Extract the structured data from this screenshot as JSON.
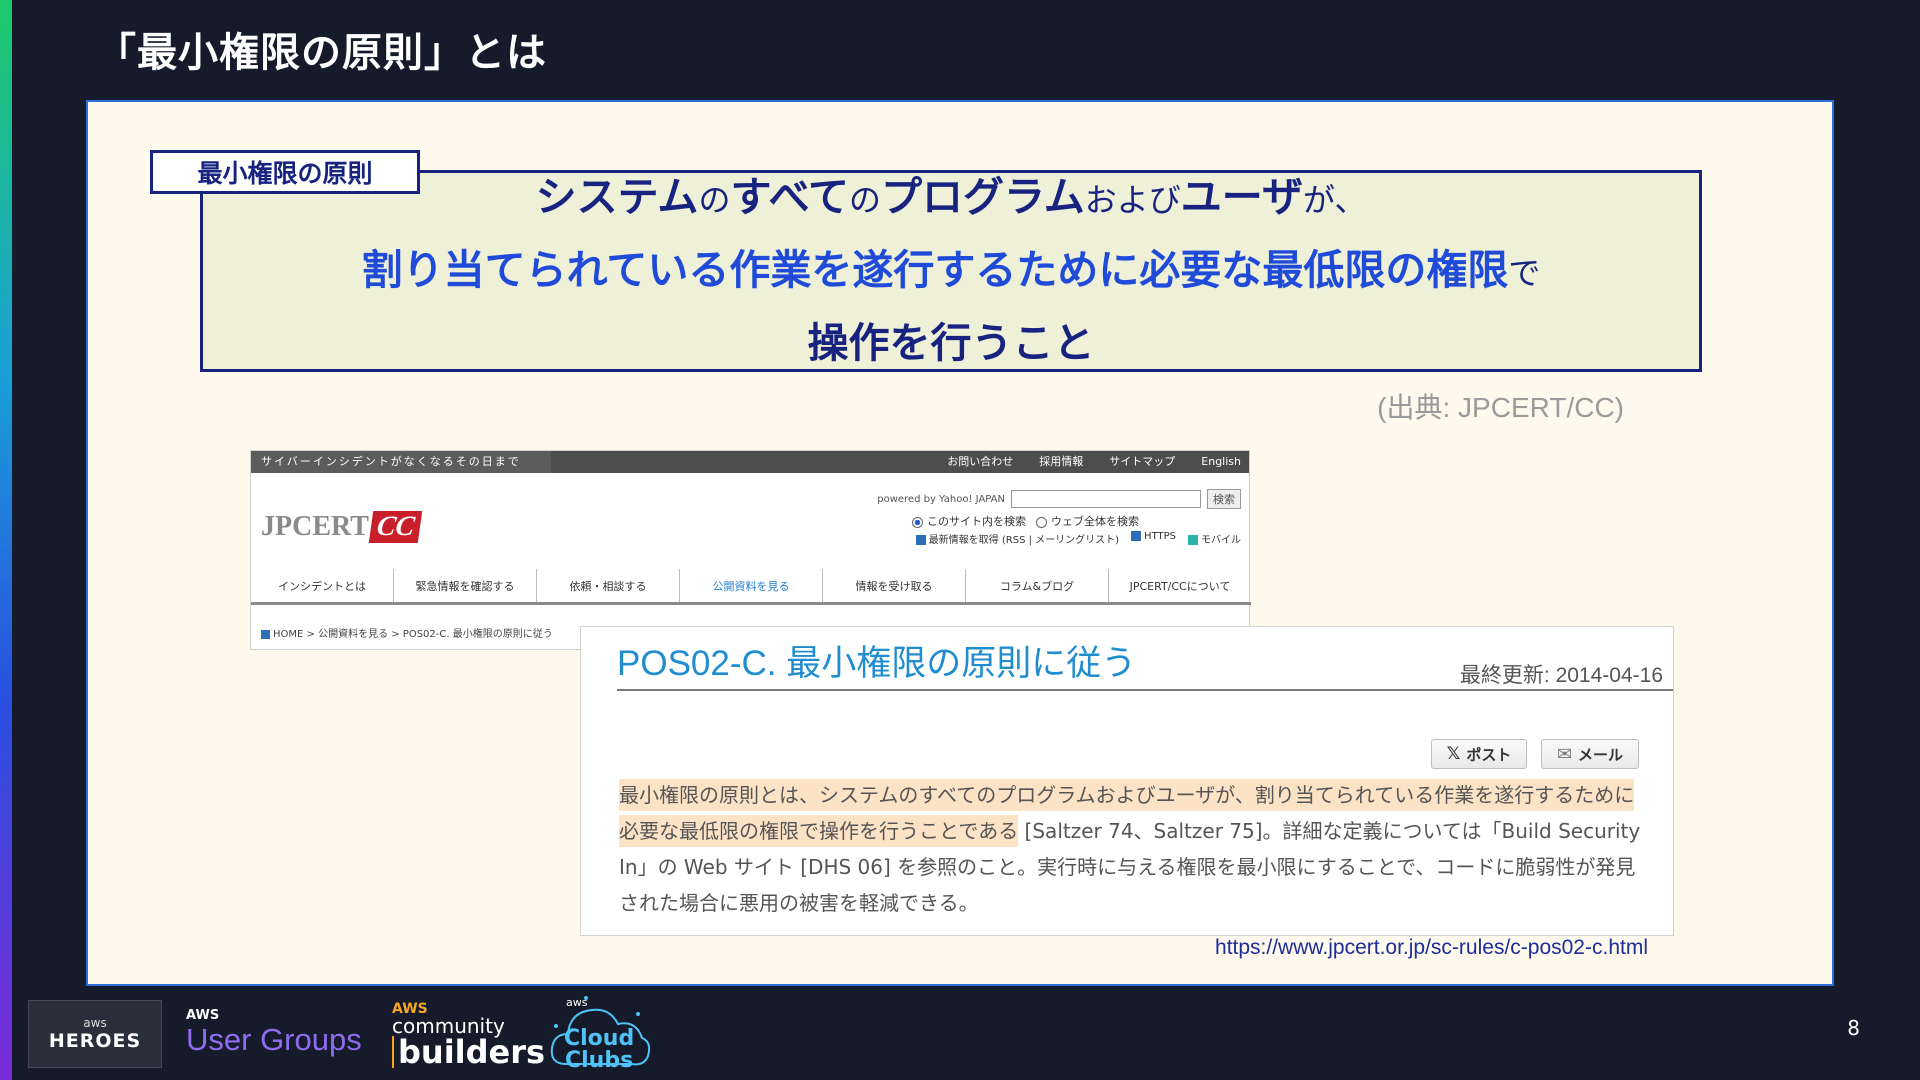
{
  "slide": {
    "title": "「最小権限の原則」とは",
    "page_number": "8"
  },
  "quote": {
    "tag": "最小権限の原則",
    "line1": [
      {
        "text": "システム",
        "size": "big",
        "color": "#17237f"
      },
      {
        "text": "の",
        "size": "small",
        "color": "#17237f"
      },
      {
        "text": "すべて",
        "size": "big",
        "color": "#17237f"
      },
      {
        "text": "の",
        "size": "small",
        "color": "#17237f"
      },
      {
        "text": "プログラム",
        "size": "big",
        "color": "#17237f"
      },
      {
        "text": "および",
        "size": "small",
        "color": "#17237f"
      },
      {
        "text": "ユーザ",
        "size": "big",
        "color": "#17237f"
      },
      {
        "text": "が、",
        "size": "small",
        "color": "#17237f"
      }
    ],
    "line2": [
      {
        "text": "割り当てられている作業を遂行するために必要な最低限の権限",
        "size": "big",
        "color": "#1f4bd8"
      },
      {
        "text": "で",
        "size": "small",
        "color": "#17237f"
      }
    ],
    "line3": [
      {
        "text": "操作を行うこと",
        "size": "big",
        "color": "#17237f"
      }
    ],
    "source": "(出典: JPCERT/CC)"
  },
  "site": {
    "tagline": "サイバーインシデントがなくなるその日まで",
    "top_links": [
      "お問い合わせ",
      "採用情報",
      "サイトマップ",
      "English"
    ],
    "logo_text": "JPCERT",
    "logo_cc": "CC",
    "powered_by": "powered by Yahoo! JAPAN",
    "search_button": "検索",
    "radio_site": "このサイト内を検索",
    "radio_web": "ウェブ全体を検索",
    "feed_rss": "最新情報を取得 (RSS | メーリングリスト)",
    "feed_https": "HTTPS",
    "feed_mobile": "モバイル",
    "nav": [
      "インシデントとは",
      "緊急情報を確認する",
      "依頼・相談する",
      "公開資料を見る",
      "情報を受け取る",
      "コラム&ブログ",
      "JPCERT/CCについて"
    ],
    "nav_active_index": 3,
    "breadcrumb": "HOME > 公開資料を見る > POS02-C. 最小権限の原則に従う"
  },
  "article": {
    "title": "POS02-C. 最小権限の原則に従う",
    "updated": "最終更新: 2014-04-16",
    "post_button": "ポスト",
    "mail_button": "メール",
    "highlight": "最小権限の原則とは、システムのすべてのプログラムおよびユーザが、割り当てられている作業を遂行するために必要な最低限の権限で操作を行うことである",
    "rest": " [Saltzer 74、Saltzer 75]。詳細な定義については「Build Security In」の Web サイト [DHS 06] を参照のこと。実行時に与える権限を最小限にすることで、コードに脆弱性が発見された場合に悪用の被害を軽減できる。"
  },
  "url": "https://www.jpcert.or.jp/sc-rules/c-pos02-c.html",
  "footer": {
    "heroes_aws": "aws",
    "heroes": "HEROES",
    "ug_aws": "AWS",
    "ug": "User Groups",
    "cb_aws": "AWS",
    "cb_community": "community",
    "cb_builders": "builders",
    "clubs_aws": "aws",
    "clubs_cloud": "Cloud",
    "clubs_clubs": "Clubs"
  }
}
